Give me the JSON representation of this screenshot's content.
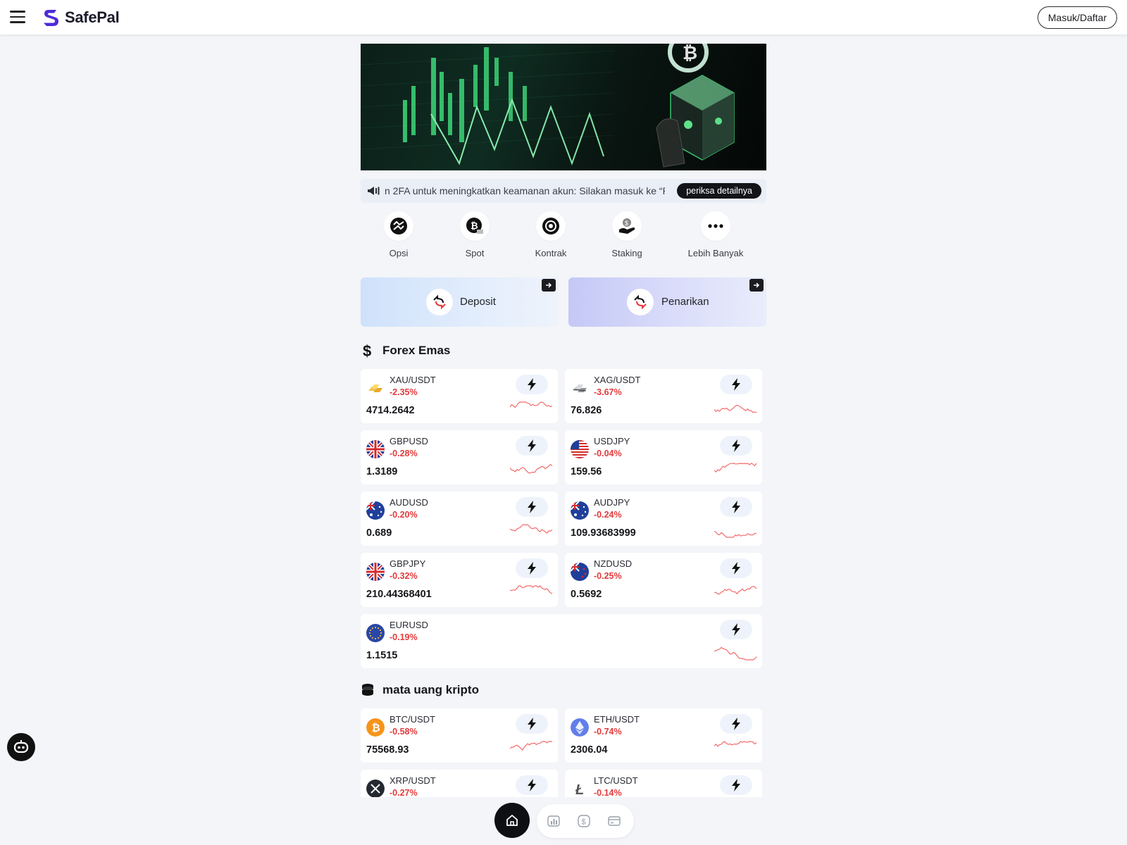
{
  "header": {
    "brand": "SafePal",
    "login_label": "Masuk/Daftar",
    "brand_color": "#4f2bd9"
  },
  "notice": {
    "text": "n 2FA untuk meningkatkan keamanan akun: Silakan masuk ke “P",
    "button_label": "periksa detailnya"
  },
  "quick_actions": [
    {
      "label": "Opsi",
      "icon": "options-icon"
    },
    {
      "label": "Spot",
      "icon": "bitcoin-spot-icon"
    },
    {
      "label": "Kontrak",
      "icon": "target-contract-icon"
    },
    {
      "label": "Staking",
      "icon": "coin-hand-staking-icon"
    },
    {
      "label": "Lebih Banyak",
      "icon": "more-dots-icon"
    }
  ],
  "deposit": {
    "label": "Deposit"
  },
  "withdraw": {
    "label": "Penarikan"
  },
  "forex": {
    "title": "Forex Emas",
    "items": [
      {
        "name": "XAU/USDT",
        "change": "-2.35%",
        "price": "4714.2642",
        "icon": "gold-bars-icon"
      },
      {
        "name": "XAG/USDT",
        "change": "-3.67%",
        "price": "76.826",
        "icon": "silver-bars-icon"
      },
      {
        "name": "GBPUSD",
        "change": "-0.28%",
        "price": "1.3189",
        "icon": "uk-flag-icon"
      },
      {
        "name": "USDJPY",
        "change": "-0.04%",
        "price": "159.56",
        "icon": "us-flag-icon"
      },
      {
        "name": "AUDUSD",
        "change": "-0.20%",
        "price": "0.689",
        "icon": "australia-flag-icon"
      },
      {
        "name": "AUDJPY",
        "change": "-0.24%",
        "price": "109.93683999",
        "icon": "australia-flag-icon"
      },
      {
        "name": "GBPJPY",
        "change": "-0.32%",
        "price": "210.44368401",
        "icon": "uk-flag-icon"
      },
      {
        "name": "NZDUSD",
        "change": "-0.25%",
        "price": "0.5692",
        "icon": "new-zealand-flag-icon"
      },
      {
        "name": "EURUSD",
        "change": "-0.19%",
        "price": "1.1515",
        "icon": "eu-flag-icon"
      }
    ]
  },
  "crypto": {
    "title": "mata uang kripto",
    "items": [
      {
        "name": "BTC/USDT",
        "change": "-0.58%",
        "price": "75568.93",
        "icon": "bitcoin-icon"
      },
      {
        "name": "ETH/USDT",
        "change": "-0.74%",
        "price": "2306.04",
        "icon": "ethereum-icon"
      },
      {
        "name": "XRP/USDT",
        "change": "-0.27%",
        "price": "",
        "icon": "xrp-icon"
      },
      {
        "name": "LTC/USDT",
        "change": "-0.14%",
        "price": "",
        "icon": "litecoin-icon"
      }
    ]
  },
  "colors": {
    "negative": "#e33a3a",
    "sparkline": "#f26b6b",
    "accent_dark": "#0e0f12"
  },
  "nav": [
    "home-icon",
    "market-chart-icon",
    "dollar-icon",
    "wallet-card-icon"
  ]
}
